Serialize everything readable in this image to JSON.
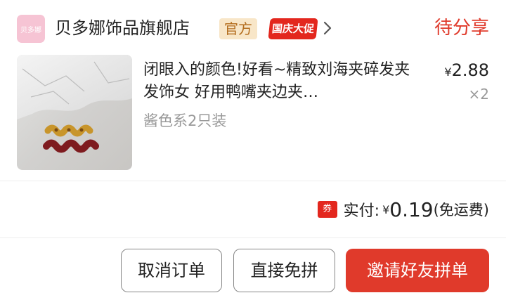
{
  "shop": {
    "logo_text": "贝多娜",
    "name": "贝多娜饰品旗舰店",
    "official_badge": "官方",
    "promo_badge": "国庆大促",
    "chevron_icon": "chevron-right-icon"
  },
  "order": {
    "status": "待分享"
  },
  "product": {
    "title": "闭眼入的颜色!好看~精致刘海夹碎发夹发饰女 好用鸭嘴夹边夹…",
    "sku": "酱色系2只装",
    "price_symbol": "¥",
    "price": "2.88",
    "quantity": "×2"
  },
  "payment": {
    "coupon_icon_text": "券",
    "paid_label": "实付:",
    "currency": "¥",
    "amount": "0.19",
    "note": "(免运费)"
  },
  "actions": {
    "cancel_label": "取消订单",
    "direct_label": "直接免拼",
    "invite_label": "邀请好友拼单"
  },
  "colors": {
    "accent": "#e03a2b",
    "official_badge_bg": "#f8e6c8",
    "official_badge_text": "#b36c1d"
  }
}
